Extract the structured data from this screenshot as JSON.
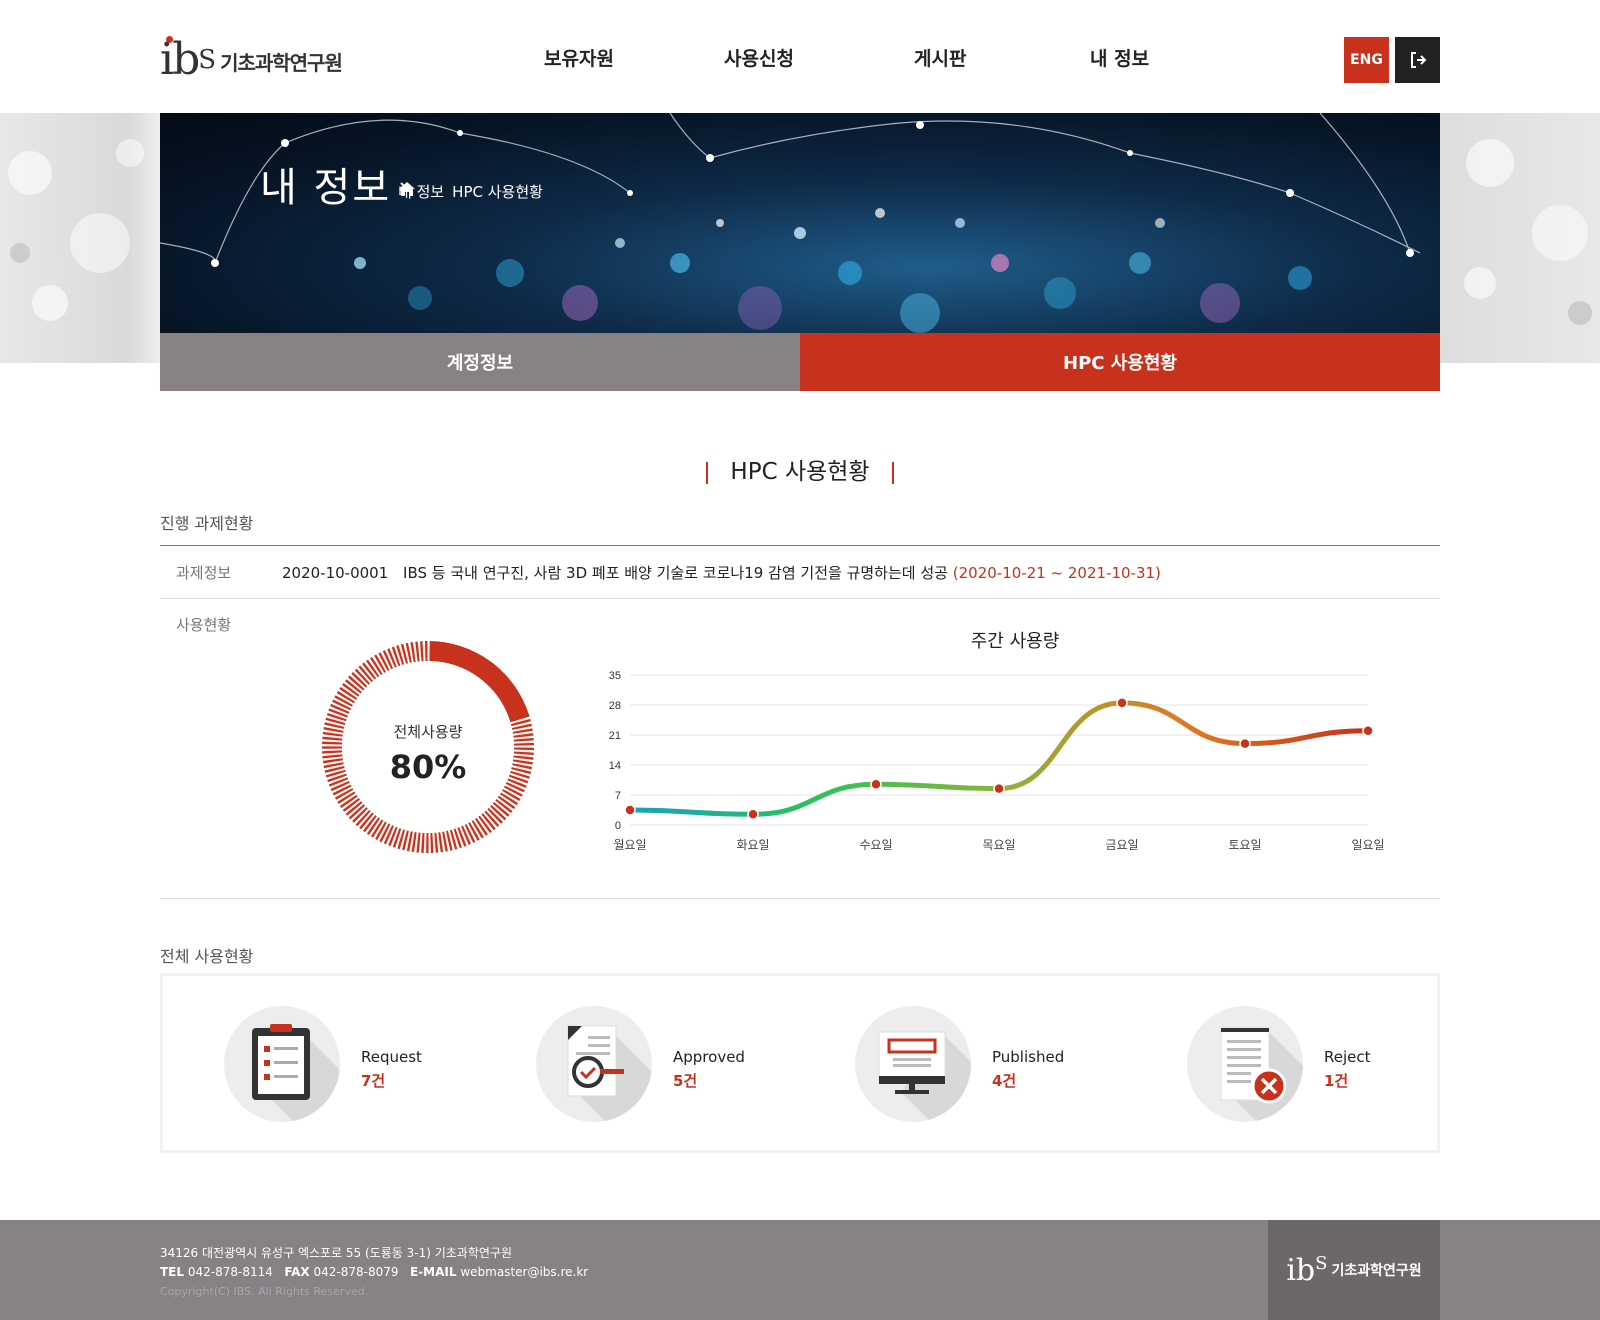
{
  "header": {
    "logo_mark": "ib",
    "logo_mark_sup": "S",
    "logo_name": "기초과학연구원",
    "nav": [
      "보유자원",
      "사용신청",
      "게시판",
      "내 정보"
    ],
    "eng_label": "ENG",
    "logout_icon": "logout-icon"
  },
  "banner": {
    "title": "내 정보",
    "breadcrumb": [
      "내 정보",
      "HPC 사용현황"
    ]
  },
  "tabs": [
    {
      "label": "계정정보",
      "active": false
    },
    {
      "label": "HPC 사용현황",
      "active": true
    }
  ],
  "page_title": "HPC 사용현황",
  "progress": {
    "heading": "진행 과제현황",
    "task_label": "과제정보",
    "task_number": "2020-10-0001",
    "task_title": "IBS 등 국내 연구진, 사람 3D 폐포 배양 기술로 코로나19 감염 기전을 규명하는데 성공",
    "task_period": "(2020-10-21 ~ 2021-10-31)",
    "usage_label": "사용현황",
    "donut_label": "전체사용량",
    "donut_value": "80%",
    "donut_fraction": 0.8
  },
  "chart_data": {
    "type": "line",
    "title": "주간 사용량",
    "categories": [
      "월요일",
      "화요일",
      "수요일",
      "목요일",
      "금요일",
      "토요일",
      "일요일"
    ],
    "values": [
      3.5,
      2.5,
      9.5,
      8.5,
      28.5,
      19,
      22
    ],
    "yticks": [
      0,
      7,
      14,
      21,
      28,
      35
    ],
    "ylim": [
      0,
      35
    ],
    "xlabel": "",
    "ylabel": "",
    "grid": true,
    "colors": [
      "#1aa0c0",
      "#2cc35a",
      "#8cb33a",
      "#e07a20",
      "#c8311b"
    ]
  },
  "summary": {
    "heading": "전체 사용현황",
    "items": [
      {
        "label": "Request",
        "count": "7건",
        "icon": "clipboard-checklist-icon"
      },
      {
        "label": "Approved",
        "count": "5건",
        "icon": "document-check-icon"
      },
      {
        "label": "Published",
        "count": "4건",
        "icon": "monitor-icon"
      },
      {
        "label": "Reject",
        "count": "1건",
        "icon": "document-reject-icon"
      }
    ]
  },
  "footer": {
    "address": "34126 대전광역시 유성구 엑스포로 55 (도룡동 3-1) 기초과학연구원",
    "tel_label": "TEL",
    "tel": "042-878-8114",
    "fax_label": "FAX",
    "fax": "042-878-8079",
    "email_label": "E-MAIL",
    "email": "webmaster@ibs.re.kr",
    "copyright": "Copyright(C) IBS. All Rights Reserved.",
    "logo_mark": "ib",
    "logo_mark_sup": "S",
    "logo_name": "기초과학연구원"
  },
  "colors": {
    "accent": "#c8311b",
    "tab_inactive": "#878085",
    "footer": "#878085",
    "footer_logo_bg": "#6d666b"
  }
}
